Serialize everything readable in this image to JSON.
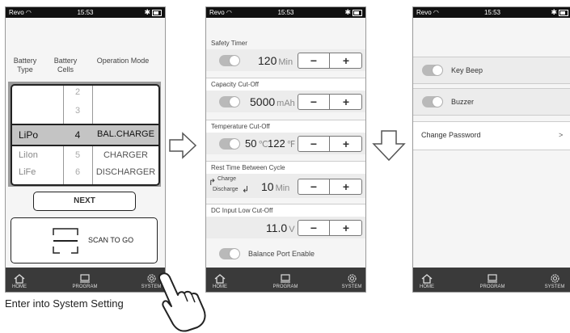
{
  "status": {
    "carrier": "Revo",
    "time": "15:53"
  },
  "nav": {
    "home": "HOME",
    "program": "PROGRAM",
    "system": "SYSTEM"
  },
  "screen1": {
    "col_battery_type": "Battery Type",
    "col_battery_cells": "Battery Cells",
    "col_operation_mode": "Operation Mode",
    "cells_above": [
      "2",
      "3"
    ],
    "selected": {
      "type": "LiPo",
      "cells": "4",
      "mode": "BAL.CHARGE"
    },
    "below": [
      {
        "type": "LiIon",
        "cells": "5",
        "mode": "CHARGER"
      },
      {
        "type": "LiFe",
        "cells": "6",
        "mode": "DISCHARGER"
      }
    ],
    "next_label": "NEXT",
    "scan_label": "SCAN TO GO"
  },
  "screen2": {
    "safety_timer": {
      "title": "Safety Timer",
      "value": "120",
      "unit": "Min"
    },
    "capacity": {
      "title": "Capacity Cut-Off",
      "value": "5000",
      "unit": "mAh"
    },
    "temperature": {
      "title": "Temperature Cut-Off",
      "c_value": "50",
      "c_unit": "℃",
      "f_value": "122",
      "f_unit": "℉"
    },
    "rest": {
      "title": "Rest Time Between Cycle",
      "charge": "Charge",
      "discharge": "Discharge",
      "value": "10",
      "unit": "Min"
    },
    "dc_input": {
      "title": "DC Input Low Cut-Off",
      "value": "11.0",
      "unit": "V"
    },
    "balance": {
      "label": "Balance Port Enable"
    },
    "stepper_minus": "−",
    "stepper_plus": "+"
  },
  "screen3": {
    "key_beep": "Key Beep",
    "buzzer": "Buzzer",
    "change_password": "Change Password",
    "chevron": ">"
  },
  "caption": "Enter into System Setting",
  "colors": {
    "nav_bg": "#3a3a3a",
    "toggle": "#b9b9b9",
    "highlight": "#c4c4c4"
  },
  "icons": [
    "wifi-icon",
    "bluetooth-icon",
    "battery-icon",
    "home-icon",
    "program-icon",
    "gear-icon",
    "arrow-right-icon",
    "arrow-down-icon",
    "hand-pointer-icon",
    "scan-frame-icon",
    "charge-icon",
    "discharge-icon"
  ]
}
